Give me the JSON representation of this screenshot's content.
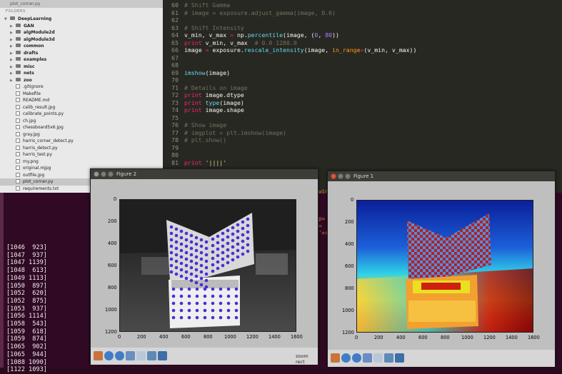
{
  "sidebar": {
    "open_file": "plot_corner.py",
    "folders_label": "FOLDERS",
    "root": "DeepLearning",
    "folders": [
      "GAN",
      "algModule2d",
      "algModule3d",
      "common",
      "drafts",
      "examples",
      "misc",
      "nets",
      "zoo"
    ],
    "files": [
      ".gitignore",
      "Makefile",
      "README.md",
      "calib_result.jpg",
      "calibrate_points.py",
      "ch.jpg",
      "chessboard5x6.jpg",
      "gray.jpg",
      "harris_corner_detect.py",
      "harris_detect.py",
      "harris_test.py",
      "my.png",
      "original.mjpg",
      "outfile.jpg",
      "plot_corner.py",
      "requirements.txt"
    ]
  },
  "editor": {
    "lines": [
      {
        "n": "60",
        "parts": [
          [
            "c-comment",
            "# Shift Gamma"
          ]
        ]
      },
      {
        "n": "61",
        "parts": [
          [
            "c-comment",
            "# image = exposure.adjust_gamma(image, 0.6)"
          ]
        ]
      },
      {
        "n": "62",
        "parts": []
      },
      {
        "n": "63",
        "parts": [
          [
            "c-comment",
            "# Shift Intensity"
          ]
        ]
      },
      {
        "n": "64",
        "parts": [
          [
            "c-plain",
            "v_min, v_max "
          ],
          [
            "c-kw",
            "="
          ],
          [
            "c-plain",
            " np."
          ],
          [
            "c-fn",
            "percentile"
          ],
          [
            "c-plain",
            "(image, ("
          ],
          [
            "c-num",
            "0"
          ],
          [
            "c-plain",
            ", "
          ],
          [
            "c-num",
            "80"
          ],
          [
            "c-plain",
            "))"
          ]
        ]
      },
      {
        "n": "65",
        "parts": [
          [
            "c-kw",
            "print"
          ],
          [
            "c-plain",
            " v_min, v_max  "
          ],
          [
            "c-comment",
            "# 0.0 1280.0"
          ]
        ]
      },
      {
        "n": "66",
        "parts": [
          [
            "c-plain",
            "image "
          ],
          [
            "c-kw",
            "="
          ],
          [
            "c-plain",
            " exposure."
          ],
          [
            "c-fn",
            "rescale_intensity"
          ],
          [
            "c-plain",
            "(image, "
          ],
          [
            "c-arg",
            "in_range"
          ],
          [
            "c-kw",
            "="
          ],
          [
            "c-plain",
            "(v_min, v_max))"
          ]
        ]
      },
      {
        "n": "67",
        "parts": []
      },
      {
        "n": "68",
        "parts": []
      },
      {
        "n": "69",
        "parts": [
          [
            "c-fn",
            "imshow"
          ],
          [
            "c-plain",
            "(image)"
          ]
        ]
      },
      {
        "n": "70",
        "parts": []
      },
      {
        "n": "71",
        "parts": [
          [
            "c-comment",
            "# Details on image"
          ]
        ]
      },
      {
        "n": "72",
        "parts": [
          [
            "c-kw",
            "print"
          ],
          [
            "c-plain",
            " image.dtype"
          ]
        ]
      },
      {
        "n": "73",
        "parts": [
          [
            "c-kw",
            "print"
          ],
          [
            "c-plain",
            " "
          ],
          [
            "c-fn",
            "type"
          ],
          [
            "c-plain",
            "(image)"
          ]
        ]
      },
      {
        "n": "74",
        "parts": [
          [
            "c-kw",
            "print"
          ],
          [
            "c-plain",
            " image.shape"
          ]
        ]
      },
      {
        "n": "75",
        "parts": []
      },
      {
        "n": "76",
        "parts": [
          [
            "c-comment",
            "# Show image"
          ]
        ]
      },
      {
        "n": "77",
        "parts": [
          [
            "c-comment",
            "# imgplot = plt.imshow(image)"
          ]
        ]
      },
      {
        "n": "78",
        "parts": [
          [
            "c-comment",
            "# plt.show()"
          ]
        ]
      },
      {
        "n": "79",
        "parts": []
      },
      {
        "n": "80",
        "parts": []
      },
      {
        "n": "81",
        "parts": [
          [
            "c-kw",
            "print"
          ],
          [
            "c-plain",
            " "
          ],
          [
            "c-str",
            "'||||'"
          ]
        ]
      }
    ]
  },
  "terminal": {
    "lines": [
      "[1046  923]",
      "[1047  937]",
      "[1047 1139]",
      "[1048  613]",
      "[1049 1113]",
      "[1050  897]",
      "[1052  620]",
      "[1052  875]",
      "[1053  937]",
      "[1056 1114]",
      "[1058  543]",
      "[1059  618]",
      "[1059  874]",
      "[1065  902]",
      "[1065  944]",
      "[1088 1090]",
      "[1122 1093]"
    ],
    "fragments": [
      "win",
      "p=",
      "=",
      "'+r"
    ]
  },
  "figure2": {
    "title": "Figure 2",
    "x_ticks": [
      "0",
      "200",
      "400",
      "600",
      "800",
      "1000",
      "1200",
      "1400",
      "1600"
    ],
    "y_ticks": [
      "0",
      "200",
      "400",
      "600",
      "800",
      "1000",
      "1200"
    ],
    "status": "zoom rect"
  },
  "figure1": {
    "title": "Figure 1",
    "x_ticks": [
      "0",
      "200",
      "400",
      "600",
      "800",
      "1000",
      "1200",
      "1400",
      "1600"
    ],
    "y_ticks": [
      "0",
      "200",
      "400",
      "600",
      "800",
      "1000",
      "1200"
    ]
  },
  "toolbar_icons": [
    "home-icon",
    "back-icon",
    "forward-icon",
    "pan-icon",
    "zoom-icon",
    "subplots-icon",
    "save-icon"
  ]
}
